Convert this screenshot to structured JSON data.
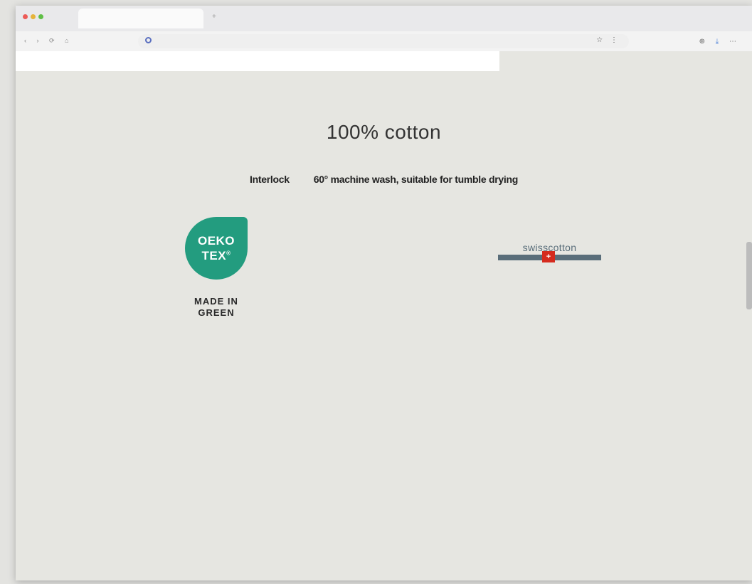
{
  "browser": {
    "tab_add_label": "+",
    "nav_icons": "‹ › ⟳ ⌂",
    "url_right_icons": "☆ ⋮",
    "ext_icon_1": "⊕",
    "ext_icon_2": "⤓",
    "ext_icon_3": "⋯"
  },
  "page": {
    "title": "100% cotton",
    "care_left": "Interlock",
    "care_right": "60° machine wash, suitable for tumble drying",
    "oeko_line1": "OEKO",
    "oeko_line2": "TEX",
    "oeko_reg": "®",
    "made_in_line1": "MADE IN",
    "made_in_line2": "GREEN",
    "swiss_logo_text": "swisscotton",
    "swiss_flag": "+",
    "left_paragraph": "",
    "right_paragraph": ""
  },
  "colors": {
    "oeko_green": "#239c7f",
    "swiss_gray": "#5a6e7a",
    "swiss_red": "#d52b1e",
    "page_bg": "#e6e6e1"
  }
}
